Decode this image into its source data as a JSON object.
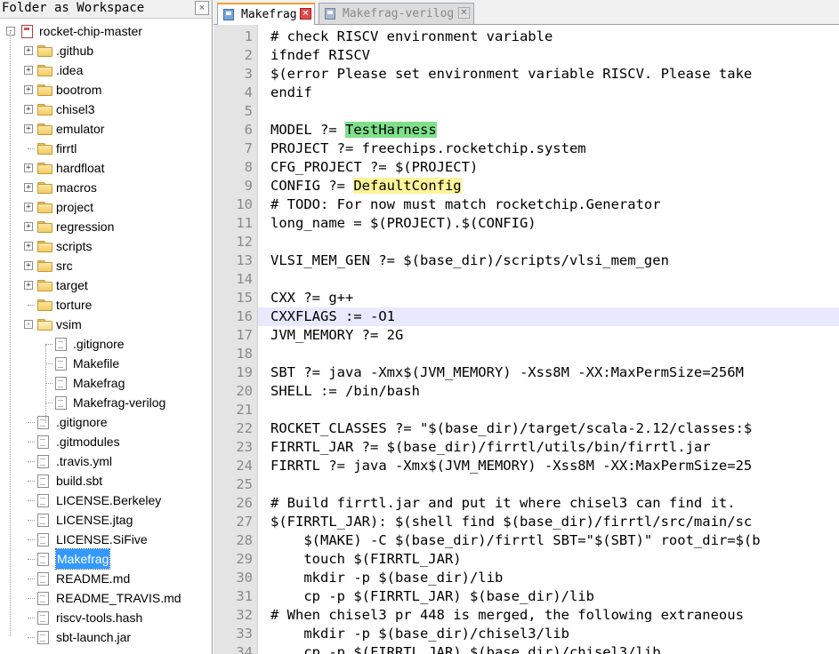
{
  "panel": {
    "title": "Folder as Workspace",
    "close_label": "×"
  },
  "tree": [
    {
      "label": "rocket-chip-master",
      "kind": "root",
      "level": 0,
      "expander": "-"
    },
    {
      "label": ".github",
      "kind": "folder",
      "level": 1,
      "expander": "+"
    },
    {
      "label": ".idea",
      "kind": "folder",
      "level": 1,
      "expander": "+"
    },
    {
      "label": "bootrom",
      "kind": "folder",
      "level": 1,
      "expander": "+"
    },
    {
      "label": "chisel3",
      "kind": "folder",
      "level": 1,
      "expander": "+"
    },
    {
      "label": "emulator",
      "kind": "folder",
      "level": 1,
      "expander": "+"
    },
    {
      "label": "firrtl",
      "kind": "folder",
      "level": 1,
      "expander": ""
    },
    {
      "label": "hardfloat",
      "kind": "folder",
      "level": 1,
      "expander": "+"
    },
    {
      "label": "macros",
      "kind": "folder",
      "level": 1,
      "expander": "+"
    },
    {
      "label": "project",
      "kind": "folder",
      "level": 1,
      "expander": "+"
    },
    {
      "label": "regression",
      "kind": "folder",
      "level": 1,
      "expander": "+"
    },
    {
      "label": "scripts",
      "kind": "folder",
      "level": 1,
      "expander": "+"
    },
    {
      "label": "src",
      "kind": "folder",
      "level": 1,
      "expander": "+"
    },
    {
      "label": "target",
      "kind": "folder",
      "level": 1,
      "expander": "+"
    },
    {
      "label": "torture",
      "kind": "folder",
      "level": 1,
      "expander": ""
    },
    {
      "label": "vsim",
      "kind": "folder-open",
      "level": 1,
      "expander": "-"
    },
    {
      "label": ".gitignore",
      "kind": "file",
      "level": 2,
      "expander": ""
    },
    {
      "label": "Makefile",
      "kind": "file",
      "level": 2,
      "expander": ""
    },
    {
      "label": "Makefrag",
      "kind": "file",
      "level": 2,
      "expander": ""
    },
    {
      "label": "Makefrag-verilog",
      "kind": "file",
      "level": 2,
      "expander": ""
    },
    {
      "label": ".gitignore",
      "kind": "file",
      "level": 1,
      "expander": ""
    },
    {
      "label": ".gitmodules",
      "kind": "file",
      "level": 1,
      "expander": ""
    },
    {
      "label": ".travis.yml",
      "kind": "file",
      "level": 1,
      "expander": ""
    },
    {
      "label": "build.sbt",
      "kind": "file",
      "level": 1,
      "expander": ""
    },
    {
      "label": "LICENSE.Berkeley",
      "kind": "file",
      "level": 1,
      "expander": ""
    },
    {
      "label": "LICENSE.jtag",
      "kind": "file",
      "level": 1,
      "expander": ""
    },
    {
      "label": "LICENSE.SiFive",
      "kind": "file",
      "level": 1,
      "expander": ""
    },
    {
      "label": "Makefrag",
      "kind": "file",
      "level": 1,
      "expander": "",
      "selected": true
    },
    {
      "label": "README.md",
      "kind": "file",
      "level": 1,
      "expander": ""
    },
    {
      "label": "README_TRAVIS.md",
      "kind": "file",
      "level": 1,
      "expander": ""
    },
    {
      "label": "riscv-tools.hash",
      "kind": "file",
      "level": 1,
      "expander": ""
    },
    {
      "label": "sbt-launch.jar",
      "kind": "file",
      "level": 1,
      "expander": ""
    }
  ],
  "tabs": [
    {
      "label": "Makefrag",
      "active": true
    },
    {
      "label": "Makefrag-verilog",
      "active": false
    }
  ],
  "editor": {
    "current_line": 16,
    "lines": [
      {
        "n": "1",
        "text": "# check RISCV environment variable"
      },
      {
        "n": "2",
        "text": "ifndef RISCV"
      },
      {
        "n": "3",
        "text": "$(error Please set environment variable RISCV. Please take"
      },
      {
        "n": "4",
        "text": "endif"
      },
      {
        "n": "5",
        "text": ""
      },
      {
        "n": "6",
        "text": "MODEL ?= ",
        "hl": "TestHarness",
        "hl_color": "green"
      },
      {
        "n": "7",
        "text": "PROJECT ?= freechips.rocketchip.system"
      },
      {
        "n": "8",
        "text": "CFG_PROJECT ?= $(PROJECT)"
      },
      {
        "n": "9",
        "text": "CONFIG ?= ",
        "hl": "DefaultConfig",
        "hl_color": "yellow"
      },
      {
        "n": "10",
        "text": "# TODO: For now must match rocketchip.Generator"
      },
      {
        "n": "11",
        "text": "long_name = $(PROJECT).$(CONFIG)"
      },
      {
        "n": "12",
        "text": ""
      },
      {
        "n": "13",
        "text": "VLSI_MEM_GEN ?= $(base_dir)/scripts/vlsi_mem_gen"
      },
      {
        "n": "14",
        "text": ""
      },
      {
        "n": "15",
        "text": "CXX ?= g++"
      },
      {
        "n": "16",
        "text": "CXXFLAGS := -O1"
      },
      {
        "n": "17",
        "text": "JVM_MEMORY ?= 2G"
      },
      {
        "n": "18",
        "text": ""
      },
      {
        "n": "19",
        "text": "SBT ?= java -Xmx$(JVM_MEMORY) -Xss8M -XX:MaxPermSize=256M"
      },
      {
        "n": "20",
        "text": "SHELL := /bin/bash"
      },
      {
        "n": "21",
        "text": ""
      },
      {
        "n": "22",
        "text": "ROCKET_CLASSES ?= \"$(base_dir)/target/scala-2.12/classes:$"
      },
      {
        "n": "23",
        "text": "FIRRTL_JAR ?= $(base_dir)/firrtl/utils/bin/firrtl.jar"
      },
      {
        "n": "24",
        "text": "FIRRTL ?= java -Xmx$(JVM_MEMORY) -Xss8M -XX:MaxPermSize=25"
      },
      {
        "n": "25",
        "text": ""
      },
      {
        "n": "26",
        "text": "# Build firrtl.jar and put it where chisel3 can find it."
      },
      {
        "n": "27",
        "text": "$(FIRRTL_JAR): $(shell find $(base_dir)/firrtl/src/main/sc"
      },
      {
        "n": "28",
        "text": "    $(MAKE) -C $(base_dir)/firrtl SBT=\"$(SBT)\" root_dir=$(b"
      },
      {
        "n": "29",
        "text": "    touch $(FIRRTL_JAR)"
      },
      {
        "n": "30",
        "text": "    mkdir -p $(base_dir)/lib"
      },
      {
        "n": "31",
        "text": "    cp -p $(FIRRTL_JAR) $(base_dir)/lib"
      },
      {
        "n": "32",
        "text": "# When chisel3 pr 448 is merged, the following extraneous"
      },
      {
        "n": "33",
        "text": "    mkdir -p $(base_dir)/chisel3/lib"
      },
      {
        "n": "34",
        "text": "    cp -p $(FIRRTL_JAR) $(base_dir)/chisel3/lib"
      }
    ]
  },
  "colors": {
    "selection": "#3399ff",
    "current_line": "#e8e8ff",
    "highlight_green": "#7ee08a",
    "highlight_yellow": "#fff59a",
    "tab_accent": "#f0a030"
  }
}
